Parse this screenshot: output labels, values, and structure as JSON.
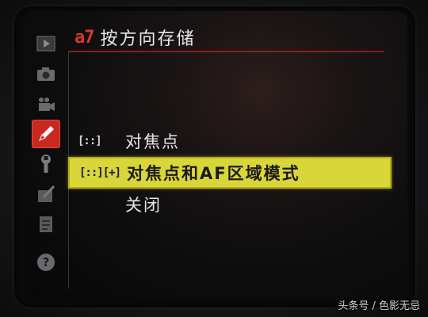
{
  "menu": {
    "code": "a7",
    "title": "按方向存储"
  },
  "sidebar": {
    "items": [
      {
        "name": "playback-menu-tab",
        "icon": "play-icon",
        "active": false
      },
      {
        "name": "shooting-menu-tab",
        "icon": "camera-icon",
        "active": false
      },
      {
        "name": "movie-menu-tab",
        "icon": "movie-camera-icon",
        "active": false
      },
      {
        "name": "custom-settings-tab",
        "icon": "pencil-icon",
        "active": true
      },
      {
        "name": "setup-menu-tab",
        "icon": "wrench-icon",
        "active": false
      },
      {
        "name": "retouch-menu-tab",
        "icon": "retouch-icon",
        "active": false
      },
      {
        "name": "my-menu-tab",
        "icon": "my-menu-icon",
        "active": false
      },
      {
        "name": "help-tab",
        "icon": "help-icon",
        "active": false
      }
    ]
  },
  "options": [
    {
      "icon_text": "[::]",
      "label": "对焦点",
      "selected": false
    },
    {
      "icon_text": "[::][+]",
      "label": "对焦点和AF区域模式",
      "selected": true
    },
    {
      "icon_text": "",
      "label": "关闭",
      "selected": false
    }
  ],
  "watermark": "头条号 / 色影无忌",
  "colors": {
    "selection_background": "#d9d63a",
    "active_tab": "#c8281f",
    "menu_code": "#d43a2f",
    "title_rule": "#8a1e1e"
  }
}
